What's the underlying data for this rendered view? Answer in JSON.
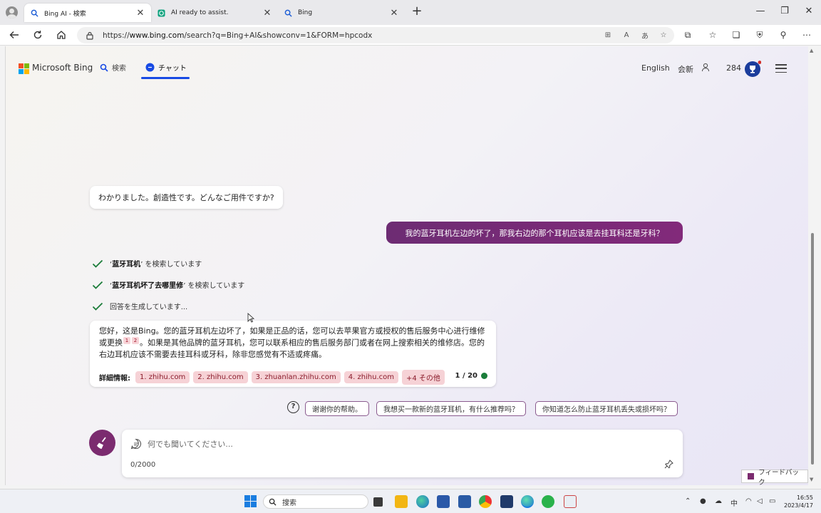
{
  "browser": {
    "tabs": [
      {
        "label": "Bing AI - 検索",
        "active": true
      },
      {
        "label": "AI ready to assist.",
        "active": false
      },
      {
        "label": "Bing",
        "active": false
      }
    ],
    "url_prefix": "https://",
    "url_host": "www.bing.com",
    "url_path": "/search?q=Bing+AI&showconv=1&FORM=hpcodx"
  },
  "header": {
    "brand": "Microsoft Bing",
    "nav_search": "検索",
    "nav_chat": "チャット",
    "language": "English",
    "signin": "会新",
    "points": "284"
  },
  "chat": {
    "bot_greeting": "わかりました。創造性です。どんなご用件ですか?",
    "user_message": "我的蓝牙耳机左边的坏了，那我右边的那个耳机应该是去挂耳科还是牙科？",
    "steps": [
      {
        "query": "蓝牙耳机",
        "suffix": "を検索しています"
      },
      {
        "query": "蓝牙耳机坏了去哪里修",
        "suffix": "を検索しています"
      },
      {
        "query": "",
        "suffix": "回答を生成しています..."
      }
    ],
    "answer_part1": "您好，这是Bing。您的蓝牙耳机左边坏了，如果是正品的话，您可以去苹果官方或授权的售后服务中心进行维修或更换",
    "answer_sup1": "1",
    "answer_sup2": "2",
    "answer_part2": "。如果是其他品牌的蓝牙耳机，您可以联系相应的售后服务部门或者在网上搜索相关的维修店。您的右边耳机应该不需要去挂耳科或牙科，除非您感觉有不适或疼痛。",
    "refs_label": "詳細情報:",
    "refs": [
      "1. zhihu.com",
      "2. zhihu.com",
      "3. zhuanlan.zhihu.com",
      "4. zhihu.com",
      "+4 その他"
    ],
    "turn_count": "1 / 20"
  },
  "suggestions": [
    "谢谢你的帮助。",
    "我想买一款新的蓝牙耳机，有什么推荐吗？",
    "你知道怎么防止蓝牙耳机丢失或损坏吗？"
  ],
  "composer": {
    "placeholder": "何でも聞いてください...",
    "char_count": "0/2000"
  },
  "feedback_label": "フィードバック",
  "taskbar": {
    "search_label": "搜索",
    "ime": "中",
    "time": "16:55",
    "date": "2023/4/17"
  },
  "colors": {
    "accent_blue": "#174ae4",
    "user_bubble": "#7a2b77",
    "ref_chip": "#f6d2d6",
    "check_green": "#1b7d3a"
  }
}
